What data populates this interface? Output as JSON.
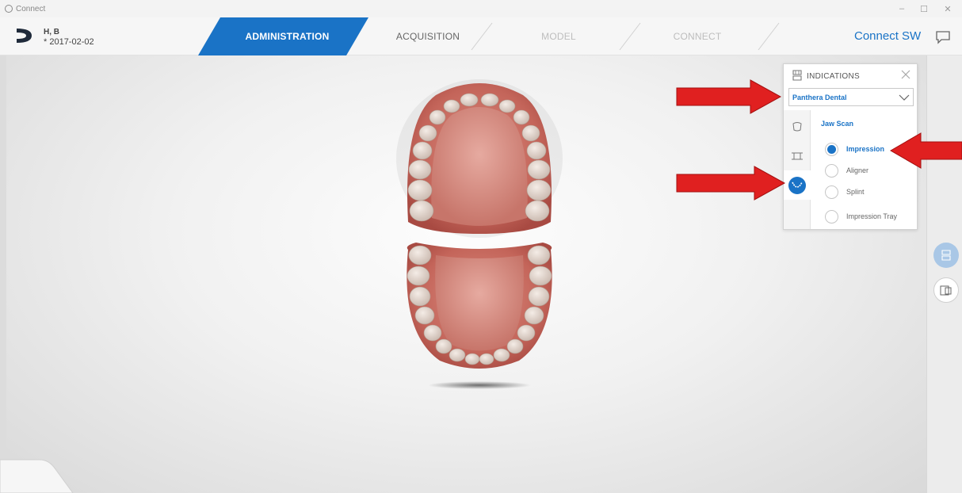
{
  "window": {
    "title": "Connect",
    "minimize_glyph": "–",
    "maximize_glyph": "☐",
    "close_glyph": "✕"
  },
  "patient": {
    "name": "H, B",
    "birthdate": "* 2017-02-02"
  },
  "tabs": [
    {
      "label": "ADMINISTRATION",
      "state": "active"
    },
    {
      "label": "ACQUISITION",
      "state": "inactive"
    },
    {
      "label": "MODEL",
      "state": "disabled"
    },
    {
      "label": "CONNECT",
      "state": "disabled"
    }
  ],
  "header": {
    "app_name": "Connect SW",
    "chat_icon": "chat-bubble-icon"
  },
  "indications": {
    "title": "INDICATIONS",
    "header_icon": "tooth-jaw-icon",
    "close_icon": "close-icon",
    "selected_lab": "Panthera Dental",
    "side_icons": [
      "single-tooth-icon",
      "bridge-icon",
      "jaw-icon"
    ],
    "selected_side_index": 2,
    "group_title": "Jaw Scan",
    "options": [
      {
        "label": "Impression",
        "selected": true
      },
      {
        "label": "Aligner",
        "selected": false
      },
      {
        "label": "Splint",
        "selected": false
      },
      {
        "label": "Impression Tray",
        "selected": false
      }
    ]
  },
  "right_toolbar": {
    "buttons": [
      "tooth-jaw-icon",
      "gallery-icon"
    ]
  },
  "colors": {
    "accent": "#1a73c6",
    "annotation_arrow": "#e02020"
  }
}
